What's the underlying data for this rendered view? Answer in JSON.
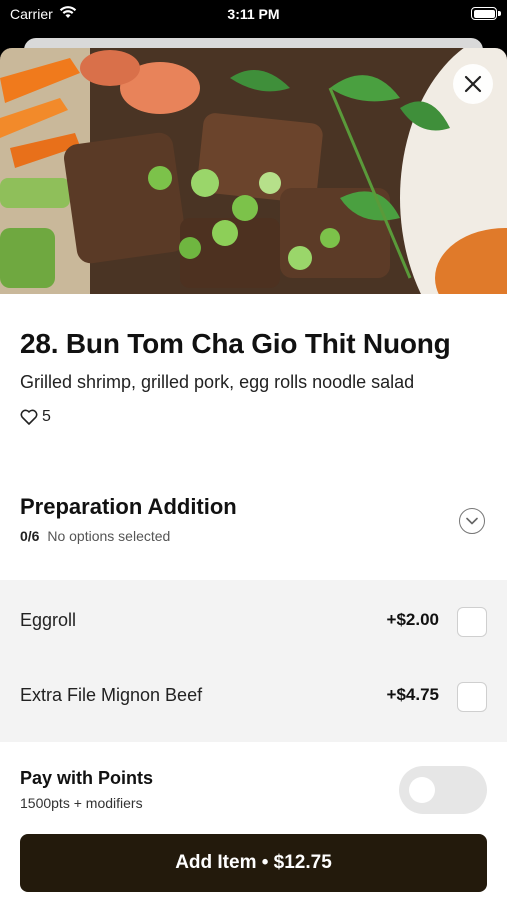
{
  "status_bar": {
    "carrier": "Carrier",
    "time": "3:11 PM"
  },
  "item": {
    "title": "28. Bun Tom Cha Gio Thit Nuong",
    "description": "Grilled shrimp, grilled pork, egg rolls noodle salad",
    "likes": "5",
    "hero_icon": "food-photo",
    "close_icon": "close-icon"
  },
  "preparation": {
    "title": "Preparation Addition",
    "count": "0/6",
    "status": "No options selected",
    "options": [
      {
        "name": "Eggroll",
        "price": "+$2.00",
        "checked": false
      },
      {
        "name": "Extra File Mignon Beef",
        "price": "+$4.75",
        "checked": false
      }
    ]
  },
  "points": {
    "title": "Pay with Points",
    "subtitle": "1500pts + modifiers",
    "enabled": false
  },
  "add_button": {
    "label": "Add Item • $12.75"
  },
  "colors": {
    "button_bg": "#231a0c",
    "options_bg": "#f3f3f3",
    "toggle_bg": "#e6e6e6"
  }
}
